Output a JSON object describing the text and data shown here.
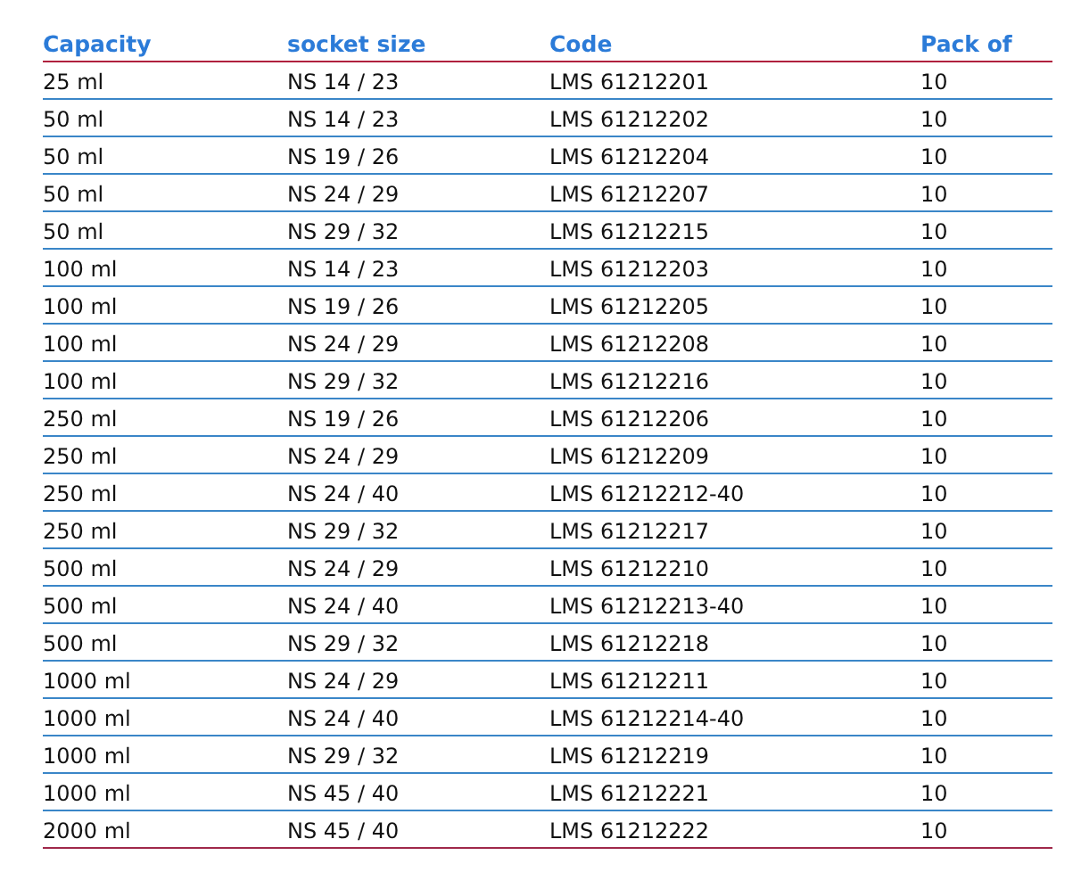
{
  "table": {
    "columns": [
      "Capacity",
      "socket size",
      "Code",
      "Pack of"
    ],
    "rows": [
      [
        "25 ml",
        "NS 14 / 23",
        "LMS 61212201",
        "10"
      ],
      [
        "50 ml",
        "NS 14 / 23",
        "LMS 61212202",
        "10"
      ],
      [
        "50 ml",
        "NS 19 / 26",
        "LMS 61212204",
        "10"
      ],
      [
        "50 ml",
        "NS 24 / 29",
        "LMS 61212207",
        "10"
      ],
      [
        "50 ml",
        "NS 29 / 32",
        "LMS 61212215",
        "10"
      ],
      [
        "100 ml",
        "NS 14 / 23",
        "LMS 61212203",
        "10"
      ],
      [
        "100 ml",
        "NS 19 / 26",
        "LMS 61212205",
        "10"
      ],
      [
        "100 ml",
        "NS 24 / 29",
        "LMS 61212208",
        "10"
      ],
      [
        "100 ml",
        "NS 29 / 32",
        "LMS 61212216",
        "10"
      ],
      [
        "250 ml",
        "NS 19 / 26",
        "LMS 61212206",
        "10"
      ],
      [
        "250 ml",
        "NS 24 / 29",
        "LMS 61212209",
        "10"
      ],
      [
        "250 ml",
        "NS 24 / 40",
        "LMS 61212212-40",
        "10"
      ],
      [
        "250 ml",
        "NS 29 / 32",
        "LMS 61212217",
        "10"
      ],
      [
        "500 ml",
        "NS 24 / 29",
        "LMS 61212210",
        "10"
      ],
      [
        "500 ml",
        "NS 24 / 40",
        "LMS 61212213-40",
        "10"
      ],
      [
        "500 ml",
        "NS 29 / 32",
        "LMS 61212218",
        "10"
      ],
      [
        "1000 ml",
        "NS 24 / 29",
        "LMS 61212211",
        "10"
      ],
      [
        "1000 ml",
        "NS 24 / 40",
        "LMS 61212214-40",
        "10"
      ],
      [
        "1000 ml",
        "NS 29 / 32",
        "LMS 61212219",
        "10"
      ],
      [
        "1000 ml",
        "NS 45 / 40",
        "LMS 61212221",
        "10"
      ],
      [
        "2000 ml",
        "NS 45 / 40",
        "LMS 61212222",
        "10"
      ]
    ]
  }
}
